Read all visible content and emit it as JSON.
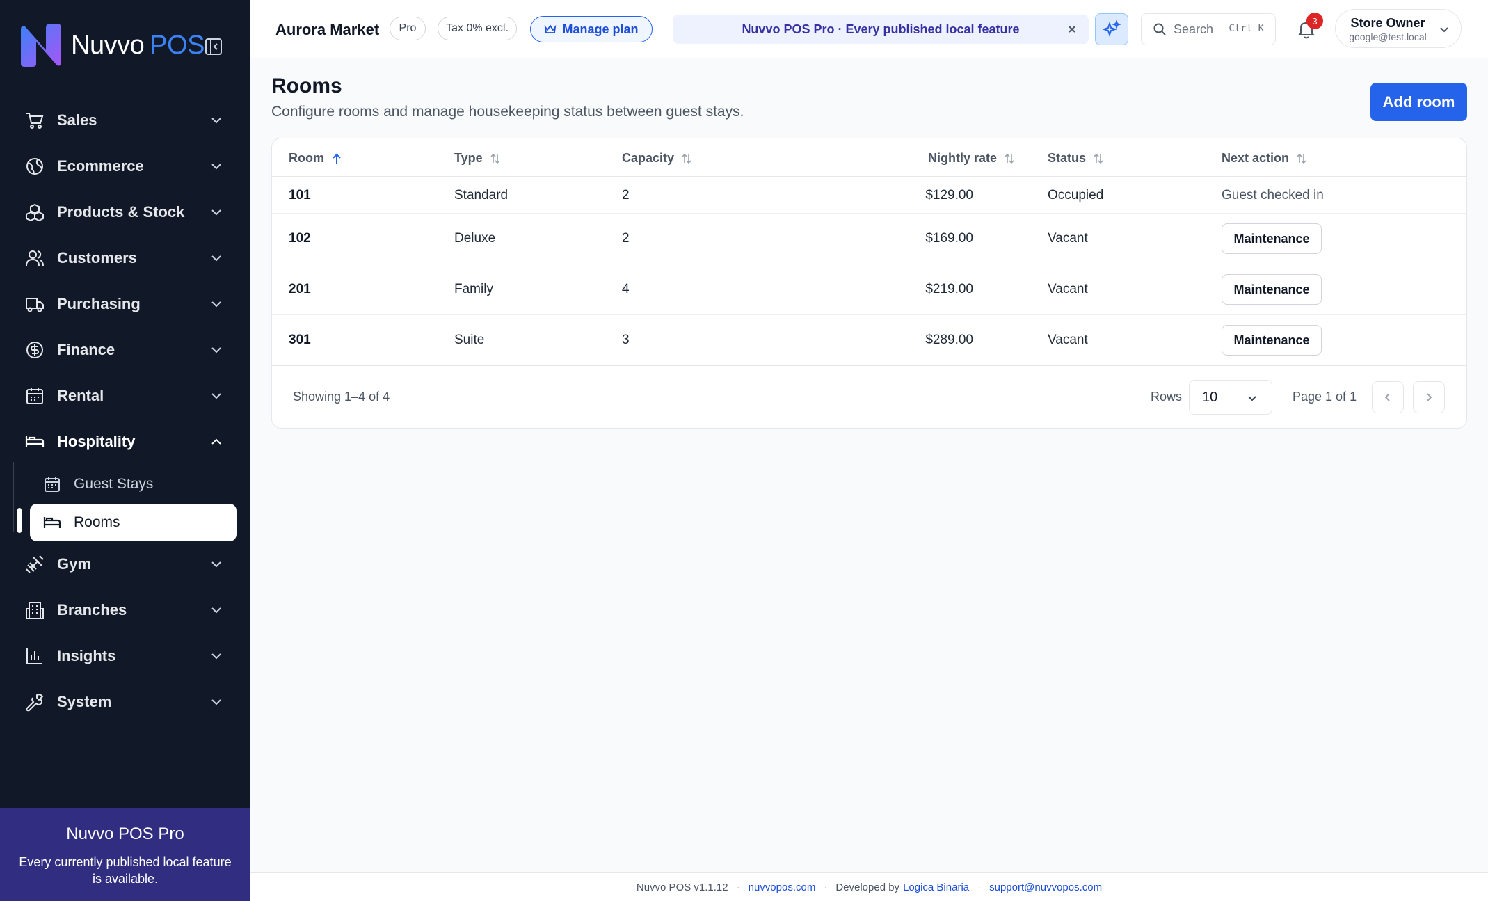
{
  "brand": {
    "name": "Nuvvo",
    "suffix": "POS"
  },
  "colors": {
    "sidebar_bg": "#111827",
    "accent": "#2563eb",
    "promo_bg": "#312e81",
    "badge": "#dc2626"
  },
  "sidebar": {
    "items": [
      {
        "label": "Sales",
        "icon": "cart-icon"
      },
      {
        "label": "Ecommerce",
        "icon": "globe-icon"
      },
      {
        "label": "Products & Stock",
        "icon": "boxes-icon"
      },
      {
        "label": "Customers",
        "icon": "users-icon"
      },
      {
        "label": "Purchasing",
        "icon": "truck-icon"
      },
      {
        "label": "Finance",
        "icon": "dollar-circle-icon"
      },
      {
        "label": "Rental",
        "icon": "calendar-icon"
      },
      {
        "label": "Hospitality",
        "icon": "bed-icon",
        "expanded": true
      },
      {
        "label": "Gym",
        "icon": "dumbbell-icon"
      },
      {
        "label": "Branches",
        "icon": "building-icon"
      },
      {
        "label": "Insights",
        "icon": "bar-chart-icon"
      },
      {
        "label": "System",
        "icon": "wrench-icon"
      }
    ],
    "hospitality_sub": [
      {
        "label": "Guest Stays",
        "icon": "calendar-icon"
      },
      {
        "label": "Rooms",
        "icon": "bed-icon",
        "active": true
      }
    ],
    "promo": {
      "title": "Nuvvo POS Pro",
      "text": "Every currently published local feature is available."
    }
  },
  "topbar": {
    "store_name": "Aurora Market",
    "plan_chip": "Pro",
    "tax_chip": "Tax 0% excl.",
    "manage_plan": "Manage plan",
    "banner": "Nuvvo POS Pro · Every published local feature",
    "search_placeholder": "Search",
    "search_shortcut": "Ctrl K",
    "notifications_count": "3",
    "user": {
      "name": "Store Owner",
      "email": "google@test.local"
    }
  },
  "page": {
    "title": "Rooms",
    "subtitle": "Configure rooms and manage housekeeping status between guest stays.",
    "add_button": "Add room"
  },
  "table": {
    "columns": [
      "Room",
      "Type",
      "Capacity",
      "Nightly rate",
      "Status",
      "Next action"
    ],
    "sorted_column": "Room",
    "rows": [
      {
        "room": "101",
        "type": "Standard",
        "capacity": "2",
        "rate": "$129.00",
        "status": "Occupied",
        "next_action": "Guest checked in",
        "next_is_button": false
      },
      {
        "room": "102",
        "type": "Deluxe",
        "capacity": "2",
        "rate": "$169.00",
        "status": "Vacant",
        "next_action": "Maintenance",
        "next_is_button": true
      },
      {
        "room": "201",
        "type": "Family",
        "capacity": "4",
        "rate": "$219.00",
        "status": "Vacant",
        "next_action": "Maintenance",
        "next_is_button": true
      },
      {
        "room": "301",
        "type": "Suite",
        "capacity": "3",
        "rate": "$289.00",
        "status": "Vacant",
        "next_action": "Maintenance",
        "next_is_button": true
      }
    ],
    "showing": "Showing 1–4 of 4",
    "rows_label": "Rows",
    "rows_per_page": "10",
    "page_label": "Page 1 of 1"
  },
  "footer": {
    "version": "Nuvvo POS v1.1.12",
    "site": "nuvvopos.com",
    "dev_prefix": "Developed by",
    "dev_name": "Logica Binaria",
    "support": "support@nuvvopos.com"
  }
}
